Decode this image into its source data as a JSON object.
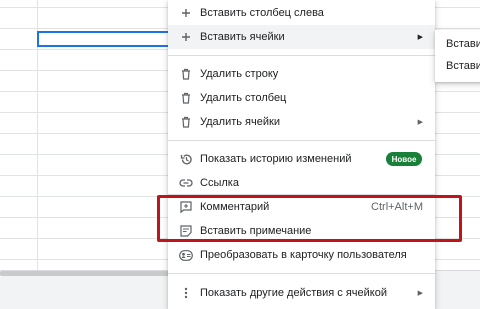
{
  "menu": {
    "items": [
      {
        "label": "Вставить столбец слева",
        "icon": "plus-icon"
      },
      {
        "label": "Вставить ячейки",
        "icon": "plus-icon"
      },
      {
        "label": "Удалить строку",
        "icon": "trash-icon"
      },
      {
        "label": "Удалить столбец",
        "icon": "trash-icon"
      },
      {
        "label": "Удалить ячейки",
        "icon": "trash-icon"
      },
      {
        "label": "Показать историю изменений",
        "icon": "history-icon",
        "badge": "Новое"
      },
      {
        "label": "Ссылка",
        "icon": "link-icon"
      },
      {
        "label": "Комментарий",
        "icon": "comment-icon",
        "shortcut": "Ctrl+Alt+M"
      },
      {
        "label": "Вставить примечание",
        "icon": "note-icon"
      },
      {
        "label": "Преобразовать в карточку пользователя",
        "icon": "person-card-icon"
      },
      {
        "label": "Показать другие действия с ячейкой",
        "icon": "more-vert-icon"
      }
    ]
  },
  "submenu": {
    "items": [
      {
        "label": "Вставить"
      },
      {
        "label": "Вставить"
      }
    ]
  },
  "colors": {
    "highlight": "#c0141b",
    "badge": "#188038",
    "selection": "#1a73e8"
  }
}
